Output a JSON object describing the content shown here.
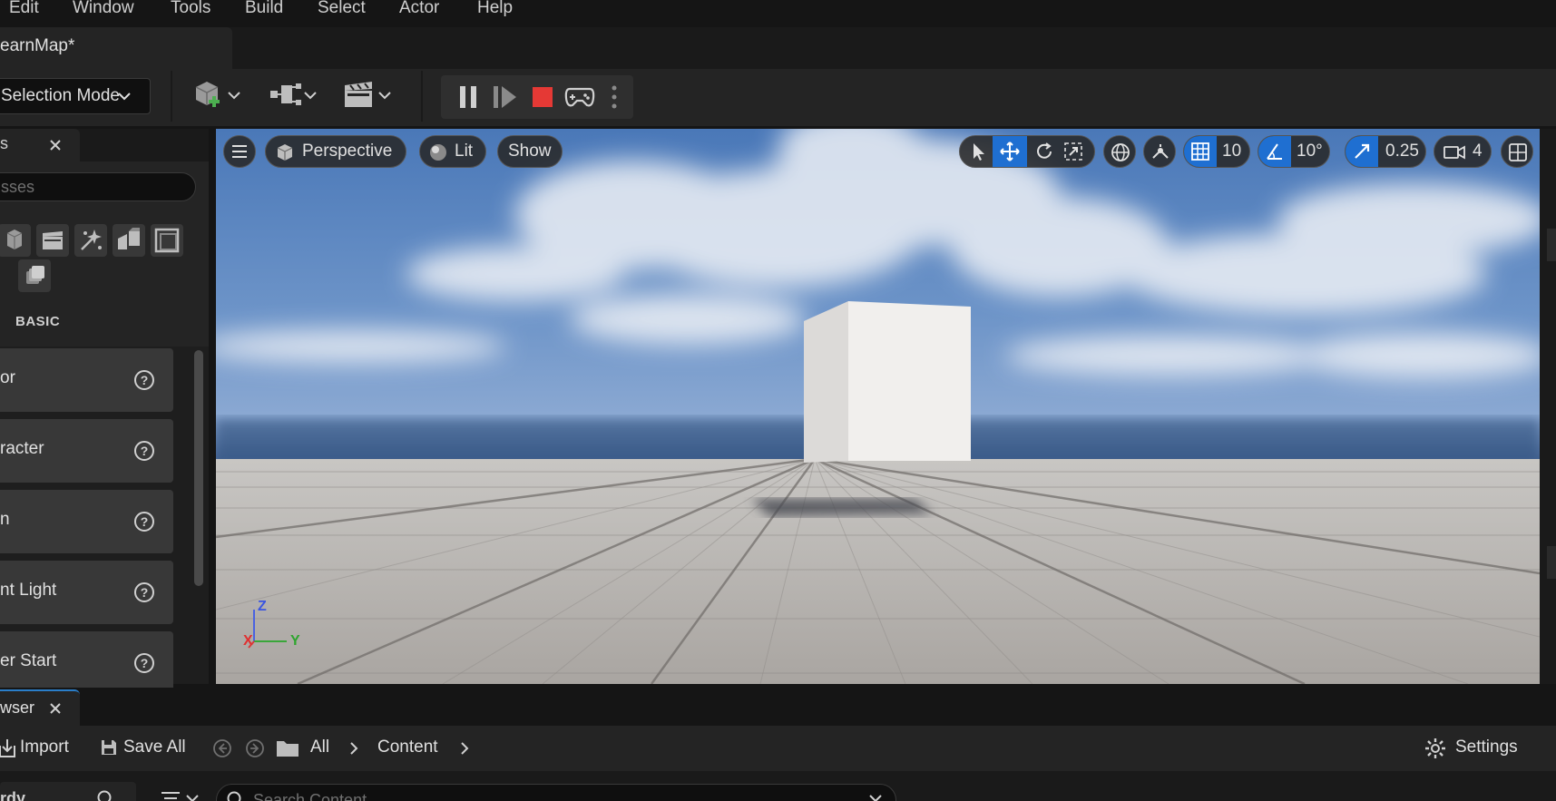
{
  "menu": [
    "Edit",
    "Window",
    "Tools",
    "Build",
    "Select",
    "Actor",
    "Help"
  ],
  "tab": {
    "title": "earnMap*"
  },
  "toolbar": {
    "selection_mode": "Selection Mode"
  },
  "place_actors": {
    "tab_label": "s",
    "search_placeholder": "sses",
    "category_label": "BASIC",
    "items": [
      "or",
      "racter",
      "n",
      "nt Light",
      "er Start"
    ]
  },
  "viewport": {
    "view_mode": "Perspective",
    "lighting": "Lit",
    "show": "Show",
    "grid_snap": "10",
    "rotation_snap": "10°",
    "scale_snap": "0.25",
    "camera_speed": "4",
    "axis": {
      "z": "Z",
      "x": "X",
      "y": "Y"
    }
  },
  "content_browser": {
    "tab_label": "wser",
    "import": "Import",
    "save_all": "Save All",
    "crumbs": [
      "All",
      "Content"
    ],
    "settings": "Settings",
    "left_label": "rdy",
    "search_placeholder": "Search Content"
  },
  "colors": {
    "accent": "#2a7ec9",
    "stop": "#e53935",
    "grid_active": "#1f6fd1"
  }
}
